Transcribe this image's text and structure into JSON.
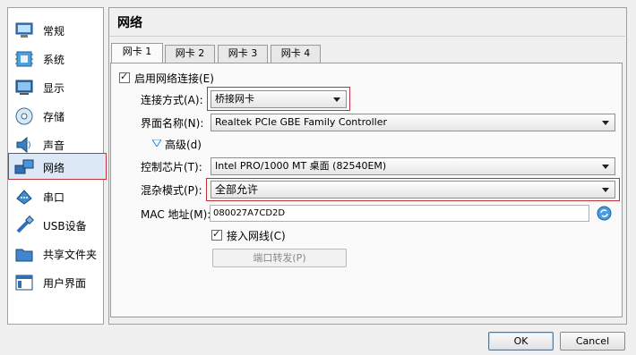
{
  "sidebar": {
    "items": [
      {
        "label": "常规",
        "icon": "monitor-icon"
      },
      {
        "label": "系统",
        "icon": "chip-icon"
      },
      {
        "label": "显示",
        "icon": "display-icon"
      },
      {
        "label": "存储",
        "icon": "disk-icon"
      },
      {
        "label": "声音",
        "icon": "speaker-icon"
      },
      {
        "label": "网络",
        "icon": "network-icon"
      },
      {
        "label": "串口",
        "icon": "serial-port-icon"
      },
      {
        "label": "USB设备",
        "icon": "usb-icon"
      },
      {
        "label": "共享文件夹",
        "icon": "folder-icon"
      },
      {
        "label": "用户界面",
        "icon": "window-icon"
      }
    ],
    "active_index": 5
  },
  "panel": {
    "title": "网络",
    "tabs": [
      "网卡 1",
      "网卡 2",
      "网卡 3",
      "网卡 4"
    ],
    "active_tab": 0
  },
  "form": {
    "enable_label": "启用网络连接(E)",
    "enable_checked": true,
    "attach_label": "连接方式(A):",
    "attach_value": "桥接网卡",
    "name_label": "界面名称(N):",
    "name_value": "Realtek PCIe GBE Family Controller",
    "advanced_label": "高级(d)",
    "adapter_label": "控制芯片(T):",
    "adapter_value": "Intel PRO/1000 MT 桌面 (82540EM)",
    "promisc_label": "混杂模式(P):",
    "promisc_value": "全部允许",
    "mac_label": "MAC 地址(M):",
    "mac_value": "080027A7CD2D",
    "cable_label": "接入网线(C)",
    "cable_checked": true,
    "port_forward_label": "端口转发(P)"
  },
  "dialog": {
    "ok_label": "OK",
    "cancel_label": "Cancel"
  },
  "colors": {
    "highlight": "#c0333a",
    "accent": "#3c7fb1"
  }
}
